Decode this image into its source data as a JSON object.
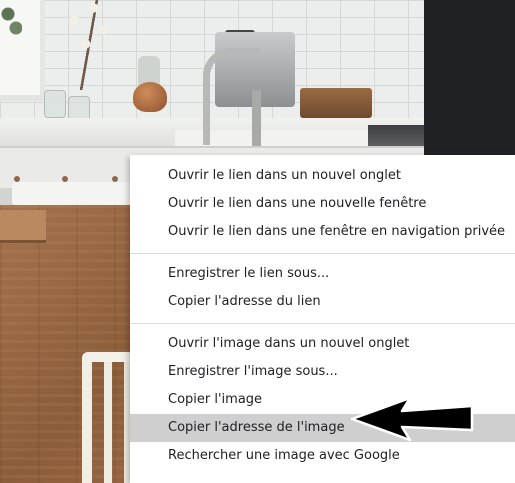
{
  "context_menu": {
    "groups": [
      [
        {
          "label": "Ouvrir le lien dans un nouvel onglet"
        },
        {
          "label": "Ouvrir le lien dans une nouvelle fenêtre"
        },
        {
          "label": "Ouvrir le lien dans une fenêtre en navigation privée"
        }
      ],
      [
        {
          "label": "Enregistrer le lien sous..."
        },
        {
          "label": "Copier l'adresse du lien"
        }
      ],
      [
        {
          "label": "Ouvrir l'image dans un nouvel onglet"
        },
        {
          "label": "Enregistrer l'image sous..."
        },
        {
          "label": "Copier l'image"
        },
        {
          "label": "Copier l'adresse de l'image",
          "highlighted": true
        },
        {
          "label": "Rechercher une image avec Google"
        }
      ]
    ]
  },
  "annotation": {
    "icon": "arrow-left-icon",
    "color": "#000000"
  },
  "colors": {
    "highlight": "#cfcfcf",
    "menu_bg": "#ffffff",
    "text": "#202124"
  }
}
